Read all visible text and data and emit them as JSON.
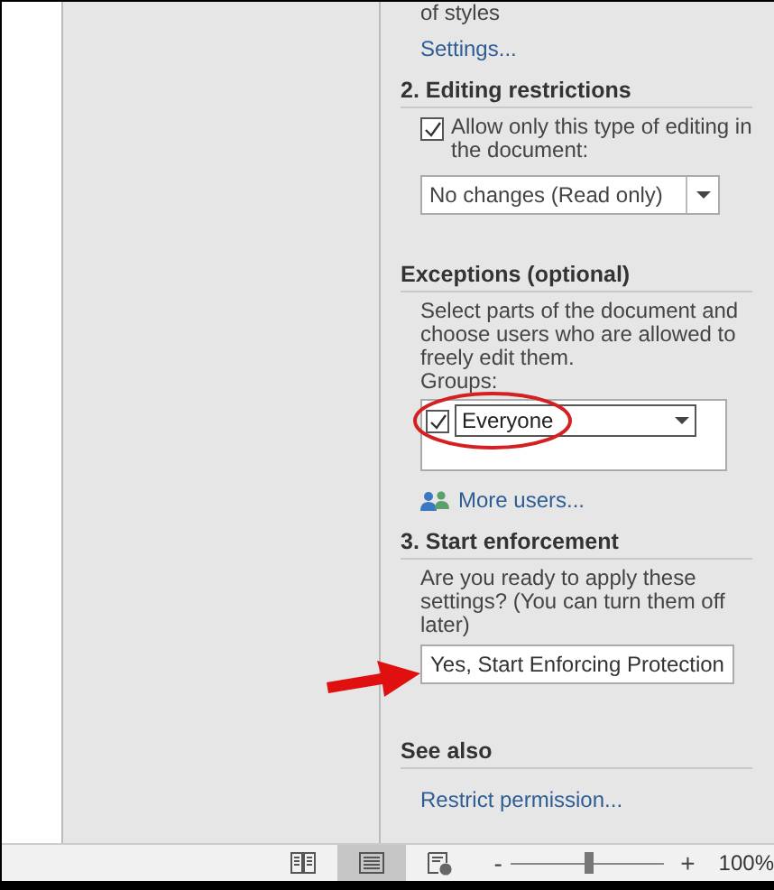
{
  "pane": {
    "top": {
      "text_tail": "of styles",
      "link": "Settings..."
    },
    "editing": {
      "heading": "2. Editing restrictions",
      "checkbox": {
        "label": "Allow only this type of editing in the document:",
        "checked": true
      },
      "dropdown": {
        "value": "No changes (Read only)"
      }
    },
    "exceptions": {
      "heading": "Exceptions (optional)",
      "description": "Select parts of the document and choose users who are allowed to freely edit them.",
      "groups_label": "Groups:",
      "groups": [
        {
          "label": "Everyone",
          "checked": true
        }
      ],
      "more_users": "More users..."
    },
    "enforcement": {
      "heading": "3. Start enforcement",
      "description": "Are you ready to apply these settings? (You can turn them off later)",
      "button": "Yes, Start Enforcing Protection"
    },
    "see_also": {
      "heading": "See also",
      "link": "Restrict permission..."
    }
  },
  "status_bar": {
    "views": [
      {
        "kind": "read",
        "selected": false
      },
      {
        "kind": "print",
        "selected": true
      },
      {
        "kind": "web",
        "selected": false
      }
    ],
    "zoom": {
      "minus": "-",
      "plus": "+",
      "level": 0.5,
      "reading": "100%"
    }
  }
}
